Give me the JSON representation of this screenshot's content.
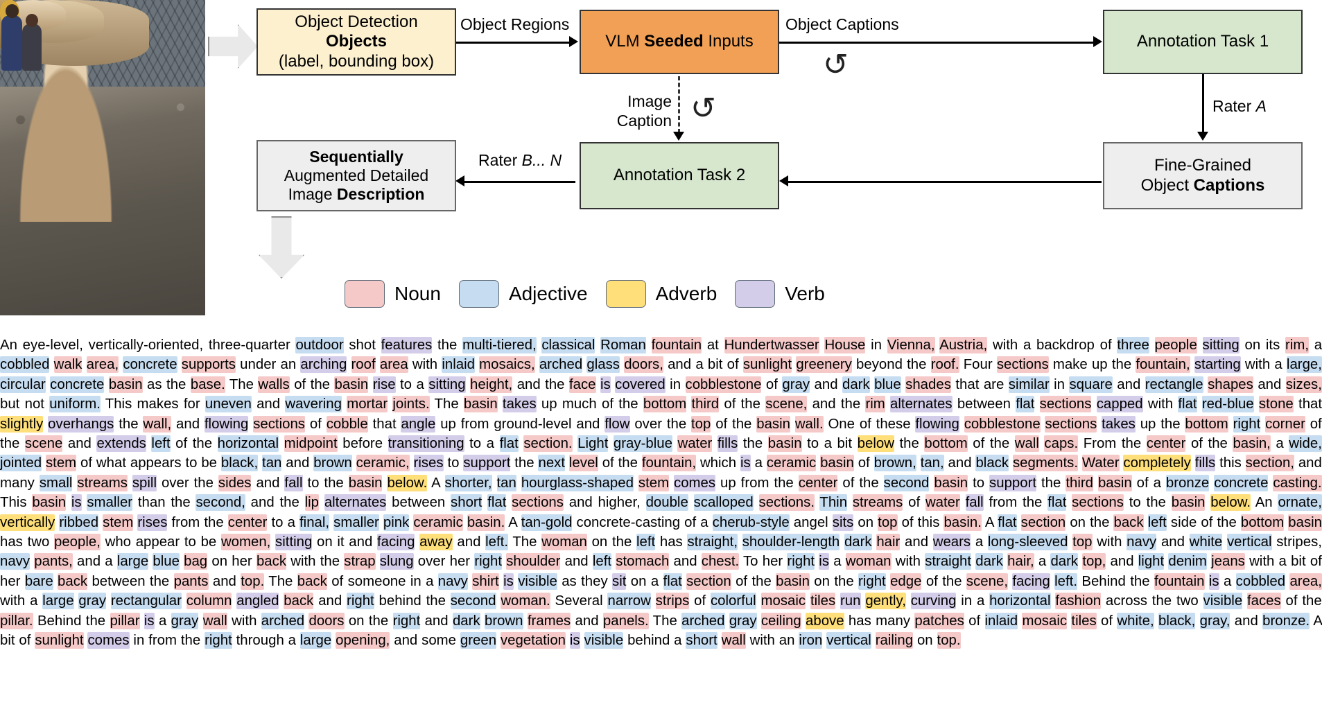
{
  "diagram": {
    "boxes": {
      "objects": {
        "lines": [
          "Object Detection",
          "Objects",
          "(label, bounding box)"
        ]
      },
      "vlm": {
        "pre": "VLM ",
        "bold": "Seeded",
        "post": " Inputs"
      },
      "task1": {
        "label": "Annotation Task 1"
      },
      "fine": {
        "line1": "Fine-Grained",
        "line2pre": "Object ",
        "line2bold": "Captions"
      },
      "task2": {
        "label": "Annotation Task 2"
      },
      "sequence": {
        "line1": "Sequentially",
        "line2": "Augmented Detailed",
        "line3pre": "Image ",
        "line3bold": "Description"
      }
    },
    "edges": {
      "object_regions": "Object Regions",
      "object_captions": "Object Captions",
      "rater_a_pre": "Rater ",
      "rater_a_em": "A",
      "rater_bn_pre": "Rater ",
      "rater_bn_em": "B... N",
      "image_caption_l1": "Image",
      "image_caption_l2": "Caption"
    },
    "icons": {
      "loop": "↺"
    }
  },
  "legend": {
    "items": [
      {
        "label": "Noun",
        "color": "#f6c9c9"
      },
      {
        "label": "Adjective",
        "color": "#c6dcf0"
      },
      {
        "label": "Adverb",
        "color": "#ffdf7a"
      },
      {
        "label": "Verb",
        "color": "#d4cde9"
      }
    ]
  },
  "description": {
    "tokens": [
      [
        "An eye-level, ",
        ""
      ],
      [
        "vertically",
        "d"
      ],
      [
        "-oriented",
        "v"
      ],
      [
        ", three-quarter ",
        ""
      ],
      [
        "outdoor",
        "a"
      ],
      [
        " shot ",
        ""
      ],
      [
        "features",
        "v"
      ],
      [
        " the ",
        ""
      ],
      [
        "multi-tiered",
        "a"
      ],
      [
        ", ",
        ""
      ],
      [
        "classical Roman",
        "a"
      ],
      [
        " ",
        ""
      ],
      [
        "fountain",
        "n"
      ],
      [
        " at ",
        ""
      ],
      [
        "Hundertwasser House",
        "n"
      ],
      [
        " in ",
        ""
      ],
      [
        "Vienna",
        "n"
      ],
      [
        ", ",
        ""
      ],
      [
        "Austria",
        "n"
      ],
      [
        ", with a backdrop of ",
        ""
      ],
      [
        "three",
        "a"
      ],
      [
        " ",
        ""
      ],
      [
        "people",
        "n"
      ],
      [
        " ",
        ""
      ],
      [
        "sitting",
        "v"
      ],
      [
        " on its ",
        ""
      ],
      [
        "rim",
        "n"
      ],
      [
        ", a ",
        ""
      ],
      [
        "cobbled",
        "a"
      ],
      [
        " ",
        ""
      ],
      [
        "walk area",
        "n"
      ],
      [
        ", ",
        ""
      ],
      [
        "concrete supports",
        "n"
      ],
      [
        " under an ",
        ""
      ],
      [
        "arching",
        "v"
      ],
      [
        " ",
        ""
      ],
      [
        "roof area",
        "n"
      ],
      [
        " with ",
        ""
      ],
      [
        "inlaid",
        "v"
      ],
      [
        " ",
        ""
      ],
      [
        "mosaics",
        "n"
      ],
      [
        ", ",
        ""
      ],
      [
        "arched glass doors",
        "a"
      ],
      [
        ", and a bit of ",
        ""
      ],
      [
        "sunlight greenery",
        "n"
      ],
      [
        " beyond ",
        " "
      ],
      [
        "the roof. Four ",
        ""
      ],
      [
        "sections",
        "n"
      ],
      [
        " make up the ",
        ""
      ],
      [
        "fountain",
        "n"
      ],
      [
        ", ",
        ""
      ],
      [
        "starting",
        "v"
      ],
      [
        " with a ",
        ""
      ],
      [
        "large, circular concrete",
        "a"
      ],
      [
        " ",
        ""
      ],
      [
        "basin",
        "n"
      ],
      [
        " as the ",
        ""
      ],
      [
        "base",
        "n"
      ],
      [
        ". The walls of the ",
        ""
      ],
      [
        "basin",
        "n"
      ],
      [
        " ",
        ""
      ],
      [
        "rise",
        "v"
      ],
      [
        " to a sitting height, and the face is ",
        ""
      ],
      [
        "covered",
        "v"
      ],
      [
        " in "
      ],
      [
        "cobblestone",
        "n"
      ],
      [
        " of ",
        ""
      ],
      [
        "gray",
        "a"
      ],
      [
        " and ",
        ""
      ],
      [
        "dark blue",
        "a"
      ],
      [
        " ",
        ""
      ],
      [
        "shades",
        "n"
      ],
      [
        " that are ",
        ""
      ],
      [
        "similar",
        "a"
      ],
      [
        " in ",
        ""
      ],
      [
        "square",
        "a"
      ],
      [
        " and ",
        ""
      ],
      [
        "rectangle",
        "a"
      ],
      [
        " ",
        ""
      ],
      [
        "shapes",
        "n"
      ],
      [
        " and ",
        ""
      ],
      [
        "sizes",
        "n"
      ],
      [
        ", but ",
        ""
      ],
      [
        "not uniform",
        "a"
      ],
      [
        ". This makes for ",
        ""
      ],
      [
        "uneven",
        "a"
      ],
      [
        " and ",
        ""
      ],
      [
        "wavering",
        "a"
      ],
      [
        " ",
        ""
      ],
      [
        "mortar joints",
        "n"
      ],
      [
        ". The "
      ],
      [
        "basin",
        "n"
      ],
      [
        " ",
        ""
      ],
      [
        "takes",
        "v"
      ],
      [
        " up much of the ",
        ""
      ],
      [
        "bottom",
        "a"
      ],
      [
        " third of the scene, and the ",
        ""
      ],
      [
        "rim",
        "n"
      ],
      [
        " ",
        ""
      ],
      [
        "alternates",
        "v"
      ],
      [
        " between ",
        ""
      ],
      [
        "flat",
        "a"
      ],
      [
        " ",
        ""
      ],
      [
        "sections",
        "n"
      ],
      [
        " ",
        ""
      ],
      [
        "capped",
        "v"
      ],
      [
        " with ",
        ""
      ],
      [
        "flat red-blue",
        "a"
      ],
      [
        " ",
        ""
      ],
      [
        "stone",
        "n"
      ],
      [
        " that ",
        ""
      ],
      [
        "slightly",
        "d"
      ],
      [
        " ",
        ""
      ],
      [
        "overhangs",
        "v"
      ],
      [
        " the wall, and ",
        ""
      ],
      [
        "flowing",
        "v"
      ]
    ],
    "full_text": "An eye-level, vertically-oriented, three-quarter outdoor shot features the multi-tiered, classical Roman fountain at Hundertwasser House in Vienna, Austria, with a backdrop of three people sitting on its rim, a cobbled walk area, concrete supports under an arching roof area with inlaid mosaics, arched glass doors, and a bit of sunlight greenery beyond the roof. Four sections make up the fountain, starting with a large, circular concrete basin as the base. The walls of the basin rise to a sitting height, and the face is covered in cobblestone of gray and dark blue shades that are similar in square and rectangle shapes and sizes, but not uniform. This makes for uneven and wavering mortar joints. The basin takes up much of the bottom third of the scene, and the rim alternates between flat sections capped with flat red-blue stone that slightly overhangs the wall, and flowing sections of cobble that angle up from ground-level and flow over the top of the basin wall. One of these flowing cobblestone sections takes up the bottom right corner of the scene and extends left of the horizontal midpoint before transitioning to a flat section. Light gray-blue water fills the basin to a bit below the bottom of the wall caps. From the center of the basin, a wide, jointed stem of what appears to be black, tan and brown ceramic, rises to support the next level of the fountain, which is a ceramic basin of brown, tan, and black segments. Water completely fills this section, and many small streams spill over the sides and fall to the basin below. A shorter, tan hourglass-shaped stem comes up from the center of the second basin to support the third basin of a bronze concrete casting. This basin is smaller than the second, and the lip alternates between short flat sections and higher, double scalloped sections. Thin streams of water fall from the flat sections to the basin below. An ornate, vertically ribbed stem rises from the center to a final, smaller pink ceramic basin. A tan-gold concrete-casting of a cherub-style angel sits on top of this basin. A flat section on the back left side of the bottom basin has two people, who appear to be women, sitting on it and facing away and left. The woman on the left has straight, shoulder-length dark hair and wears a long-sleeved top with navy and white vertical stripes, navy pants, and a large blue bag on her back with the strap slung over her right shoulder and left stomach and chest. To her right is a woman with straight dark hair, a dark top, and light denim jeans with a bit of her bare back between the pants and top. The back of someone in a navy shirt is visible as they sit on a flat section of the basin on the right edge of the scene, facing left. Behind the fountain is a cobbled area, with a large gray rectangular column angled back and right behind the second woman. Several narrow strips of colorful mosaic tiles run gently, curving in a horizontal fashion across the two visible faces of the pillar. Behind the pillar is a gray wall with arched doors on the right and dark brown frames and panels. The arched gray ceiling above has many patches of inlaid mosaic tiles of white, black, gray, and bronze. A bit of sunlight comes in from the right through a large opening, and some green vegetation is visible behind a short wall with an iron vertical railing on top."
  }
}
